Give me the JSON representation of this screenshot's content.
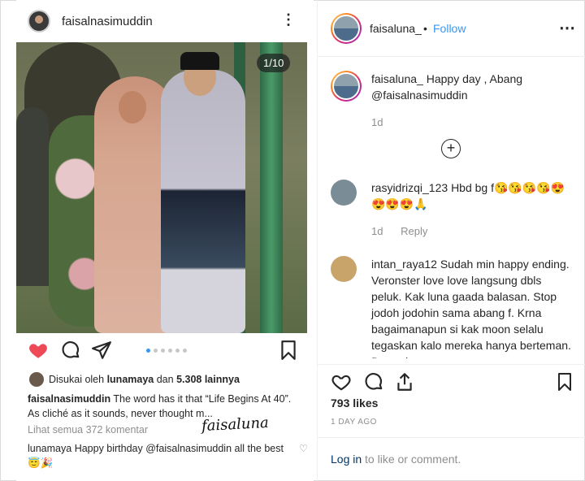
{
  "left_post": {
    "username": "faisalnasimuddin",
    "photo_counter": "1/10",
    "liked_by_prefix": "Disukai oleh",
    "liked_by_user": "lunamaya",
    "liked_by_suffix": "dan",
    "liked_by_count": "5.308 lainnya",
    "caption_user": "faisalnasimuddin",
    "caption_text": "The word has it that “Life Begins At 40”. As cliché as it sounds, never thought m...",
    "view_all_comments": "Lihat semua 372 komentar",
    "watermark": "faisaluna",
    "comment_user": "lunamaya",
    "comment_text": "Happy birthday @faisalnasimuddin all the best 😇🎉",
    "carousel_total": 6,
    "carousel_active": 0
  },
  "header": {
    "username": "faisaluna_",
    "separator": "•",
    "follow_label": "Follow",
    "more_label": "⋯"
  },
  "comments": [
    {
      "user": "faisaluna_",
      "text": "Happy day , Abang @faisalnasimuddin",
      "time": "1d",
      "reply": ""
    },
    {
      "user": "rasyidrizqi_123",
      "text": "Hbd bg f😘😘😘😘😍😍😍😍🙏",
      "time": "1d",
      "reply": "Reply"
    },
    {
      "user": "intan_raya12",
      "text": "Sudah min happy ending. Veronster love love langsung dbls peluk. Kak luna gaada balasan. Stop jodoh jodohin sama abang f. Krna bagaimanapun si kak moon selalu tegaskan kalo mereka hanya berteman. Dan uda"
    }
  ],
  "load_more_icon": "plus-circle-icon",
  "likes": "793 likes",
  "date": "1 DAY AGO",
  "login": {
    "link": "Log in",
    "rest": " to like or comment."
  },
  "colors": {
    "accent": "#3897f0",
    "heart": "#ed4956",
    "muted": "#8e8e8e"
  }
}
